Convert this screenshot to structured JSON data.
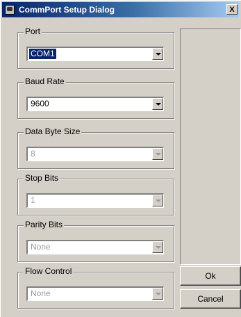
{
  "window": {
    "title": "CommPort Setup Dialog",
    "close_label": "X"
  },
  "groups": [
    {
      "label": "Port",
      "value": "COM1",
      "enabled": true,
      "selected": true
    },
    {
      "label": "Baud Rate",
      "value": "9600",
      "enabled": true,
      "selected": false
    },
    {
      "label": "Data Byte Size",
      "value": "8",
      "enabled": false,
      "selected": false
    },
    {
      "label": "Stop Bits",
      "value": "1",
      "enabled": false,
      "selected": false
    },
    {
      "label": "Parity Bits",
      "value": "None",
      "enabled": false,
      "selected": false
    },
    {
      "label": "Flow Control",
      "value": "None",
      "enabled": false,
      "selected": false
    }
  ],
  "buttons": {
    "ok_label": "Ok",
    "cancel_label": "Cancel"
  },
  "icons": [
    "app-icon",
    "close-icon",
    "dropdown-arrow-icon"
  ]
}
